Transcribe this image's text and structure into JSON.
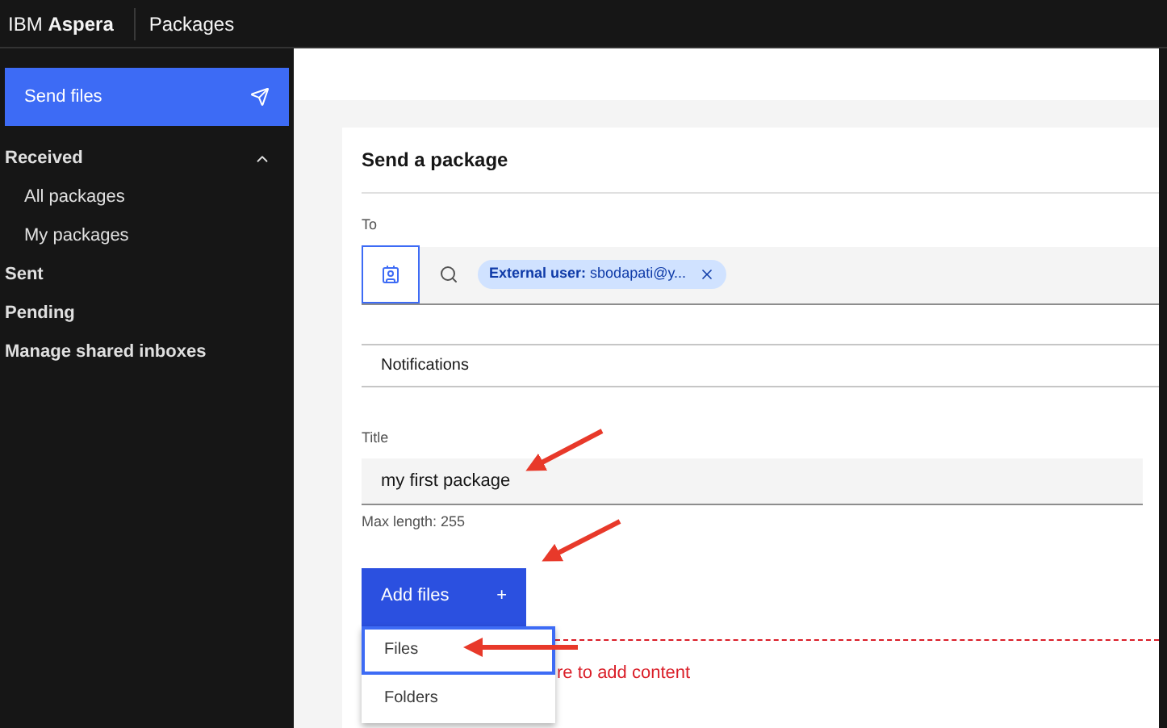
{
  "header": {
    "brand_prefix": "IBM",
    "brand_name": "Aspera",
    "section": "Packages"
  },
  "sidebar": {
    "send_button": "Send files",
    "items": [
      {
        "label": "Received",
        "expanded": true,
        "children": [
          {
            "label": "All packages"
          },
          {
            "label": "My packages"
          }
        ]
      },
      {
        "label": "Sent"
      },
      {
        "label": "Pending"
      },
      {
        "label": "Manage shared inboxes"
      }
    ]
  },
  "form": {
    "title": "Send a package",
    "to_label": "To",
    "recipient_chip": {
      "kind_label": "External user:",
      "value": "sbodapati@y..."
    },
    "notifications": "Notifications",
    "title_label": "Title",
    "title_value": "my first package",
    "title_helper": "Max length: 255",
    "add_button": "Add files",
    "add_icon": "+",
    "menu": [
      {
        "label": "Files",
        "selected": true
      },
      {
        "label": "Folders",
        "selected": false
      }
    ],
    "drop_hint": "re to add content"
  }
}
